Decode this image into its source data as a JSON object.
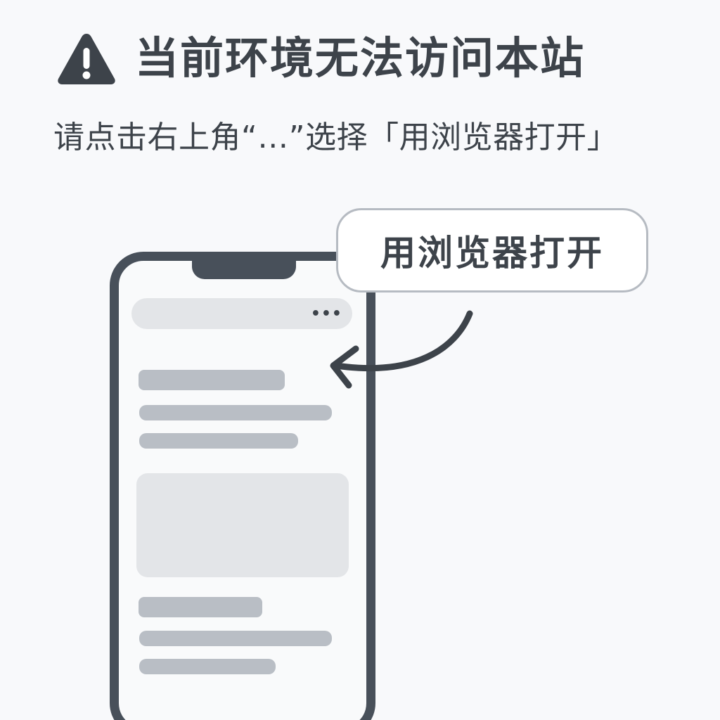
{
  "header": {
    "icon": "warning-triangle-icon",
    "title": "当前环境无法访问本站"
  },
  "instructions": {
    "text": "请点击右上角“…”选择「用浏览器打开」"
  },
  "phone": {
    "menu_icon": "more-dots-icon",
    "menu_label": "•••"
  },
  "callout": {
    "label": "用浏览器打开"
  },
  "colors": {
    "background": "#f8f9fb",
    "text": "#3d434a",
    "phone_frame": "#48505a",
    "placeholder_bar": "#b9bec5",
    "placeholder_block": "#e3e5e8",
    "callout_border": "#b6bbc2"
  }
}
